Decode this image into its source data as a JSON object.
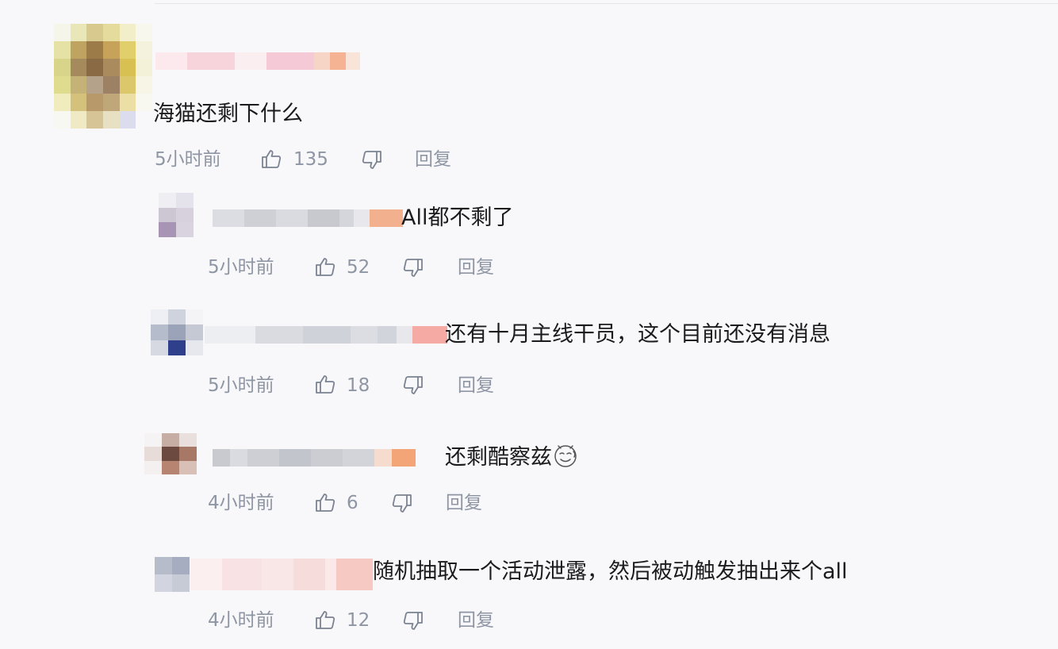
{
  "comments": [
    {
      "text": "海猫还剩下什么",
      "time": "5小时前",
      "likes": "135",
      "reply_label": "回复",
      "emoji": false
    },
    {
      "text": "All都不剩了",
      "time": "5小时前",
      "likes": "52",
      "reply_label": "回复",
      "emoji": false
    },
    {
      "text": "还有十月主线干员，这个目前还没有消息",
      "time": "5小时前",
      "likes": "18",
      "reply_label": "回复",
      "emoji": false
    },
    {
      "text": "还剩酷察兹",
      "time": "4小时前",
      "likes": "6",
      "reply_label": "回复",
      "emoji": true
    },
    {
      "text": "随机抽取一个活动泄露，然后被动触发抽出来个all",
      "time": "4小时前",
      "likes": "12",
      "reply_label": "回复",
      "emoji": false
    }
  ],
  "colors": {
    "meta_text": "#8e95a3",
    "body_text": "#1b1b1b",
    "background": "#f8f8fb"
  },
  "icons": [
    "thumbs-up-icon",
    "thumbs-down-icon",
    "smile-emoji-icon"
  ]
}
